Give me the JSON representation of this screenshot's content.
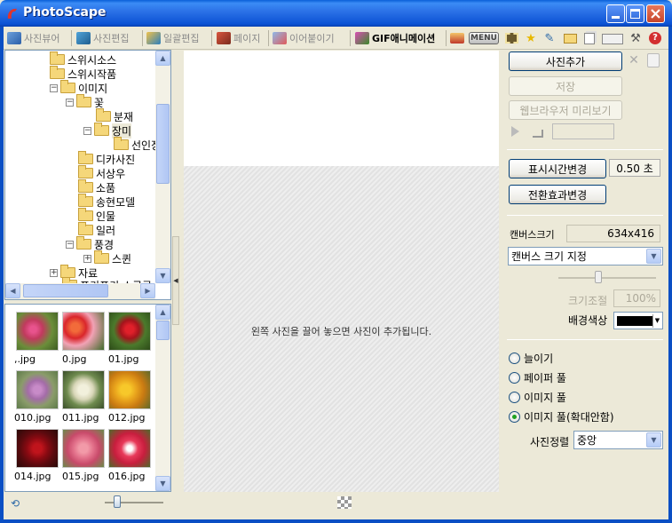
{
  "window": {
    "title": "PhotoScape"
  },
  "tabs": [
    {
      "label": "사진뷰어"
    },
    {
      "label": "사진편집"
    },
    {
      "label": "일괄편집"
    },
    {
      "label": "페이지"
    },
    {
      "label": "이어붙이기"
    },
    {
      "label": "GIF애니메이션"
    }
  ],
  "toolbar": {
    "menu_label": "MENU"
  },
  "tree": {
    "nodes": [
      {
        "label": "스위시소스"
      },
      {
        "label": "스위시작품"
      },
      {
        "label": "이미지"
      },
      {
        "label": "꽃"
      },
      {
        "label": "분재"
      },
      {
        "label": "장미"
      },
      {
        "label": "선인장"
      },
      {
        "label": "디카사진"
      },
      {
        "label": "서상우"
      },
      {
        "label": "소품"
      },
      {
        "label": "송현모델"
      },
      {
        "label": "인물"
      },
      {
        "label": "일러"
      },
      {
        "label": "풍경"
      },
      {
        "label": "스퀸"
      },
      {
        "label": "자료"
      },
      {
        "label": "포키포키 소금공"
      }
    ]
  },
  "thumbnails": [
    {
      "name": ",.jpg"
    },
    {
      "name": "0.jpg"
    },
    {
      "name": "01.jpg"
    },
    {
      "name": "010.jpg"
    },
    {
      "name": "011.jpg"
    },
    {
      "name": "012.jpg"
    },
    {
      "name": "014.jpg"
    },
    {
      "name": "015.jpg"
    },
    {
      "name": "016.jpg"
    }
  ],
  "canvas": {
    "drop_hint": "왼쪽 사진을 끌어 놓으면 사진이 추가됩니다."
  },
  "right": {
    "add_photo": "사진추가",
    "save": "저장",
    "web_preview": "웹브라우저 미리보기",
    "display_time_btn": "표시시간변경",
    "display_time_value": "0.50 초",
    "transition_btn": "전환효과변경",
    "canvas_size_label": "캔버스크기",
    "canvas_size_value": "634x416",
    "canvas_size_select": "캔버스 크기 지정",
    "size_adjust_label": "크기조절",
    "size_adjust_value": "100%",
    "bg_color_label": "배경색상",
    "bg_color": "#000000",
    "options": [
      {
        "label": "늘이기",
        "selected": false
      },
      {
        "label": "페이퍼 풀",
        "selected": false
      },
      {
        "label": "이미지 풀",
        "selected": false
      },
      {
        "label": "이미지 풀(확대안함)",
        "selected": true
      }
    ],
    "align_label": "사진정렬",
    "align_value": "중앙"
  }
}
